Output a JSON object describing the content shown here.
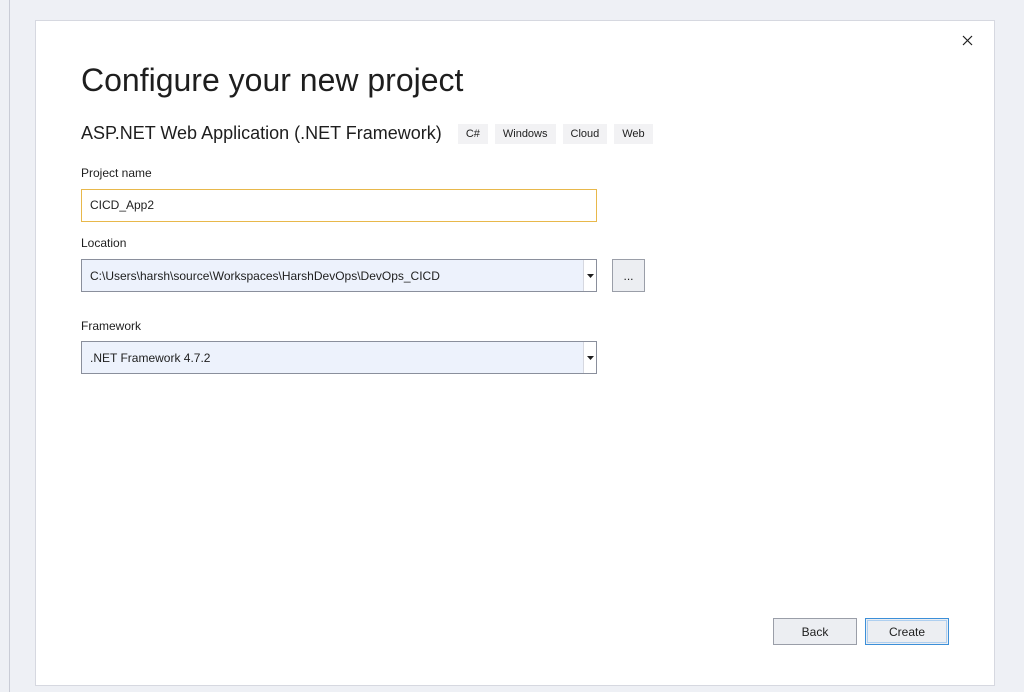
{
  "dialog": {
    "title": "Configure your new project",
    "template_name": "ASP.NET Web Application (.NET Framework)",
    "tags": [
      "C#",
      "Windows",
      "Cloud",
      "Web"
    ]
  },
  "project_name": {
    "label": "Project name",
    "value": "CICD_App2"
  },
  "location": {
    "label": "Location",
    "value": "C:\\Users\\harsh\\source\\Workspaces\\HarshDevOps\\DevOps_CICD",
    "browse_label": "..."
  },
  "framework": {
    "label": "Framework",
    "value": ".NET Framework 4.7.2"
  },
  "buttons": {
    "back": "Back",
    "create": "Create"
  },
  "icons": {
    "close": "close-icon",
    "dropdown": "chevron-down-icon"
  },
  "colors": {
    "focus_border": "#e8b84b",
    "primary_border": "#3c8fd8",
    "combo_background": "#edf2fc"
  }
}
